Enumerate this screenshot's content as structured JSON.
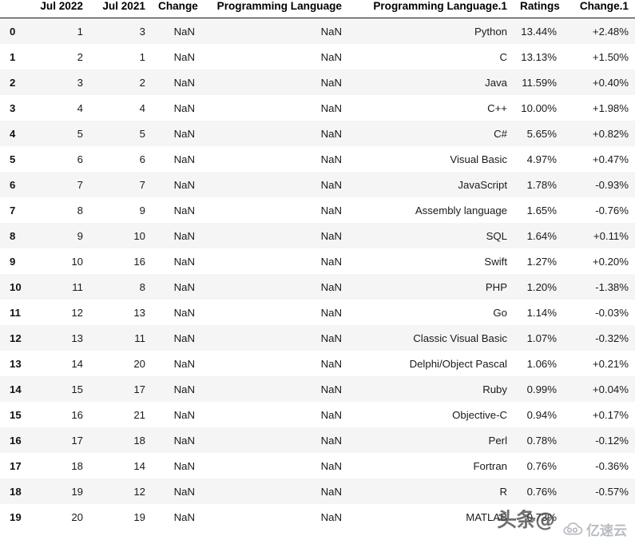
{
  "table": {
    "index_header": "",
    "columns": [
      "Jul 2022",
      "Jul 2021",
      "Change",
      "Programming Language",
      "Programming Language.1",
      "Ratings",
      "Change.1"
    ],
    "index": [
      "0",
      "1",
      "2",
      "3",
      "4",
      "5",
      "6",
      "7",
      "8",
      "9",
      "10",
      "11",
      "12",
      "13",
      "14",
      "15",
      "16",
      "17",
      "18",
      "19"
    ],
    "rows": [
      {
        "idx": "0",
        "jul2022": "1",
        "jul2021": "3",
        "change": "NaN",
        "lang": "NaN",
        "lang1": "Python",
        "ratings": "13.44%",
        "change1": "+2.48%"
      },
      {
        "idx": "1",
        "jul2022": "2",
        "jul2021": "1",
        "change": "NaN",
        "lang": "NaN",
        "lang1": "C",
        "ratings": "13.13%",
        "change1": "+1.50%"
      },
      {
        "idx": "2",
        "jul2022": "3",
        "jul2021": "2",
        "change": "NaN",
        "lang": "NaN",
        "lang1": "Java",
        "ratings": "11.59%",
        "change1": "+0.40%"
      },
      {
        "idx": "3",
        "jul2022": "4",
        "jul2021": "4",
        "change": "NaN",
        "lang": "NaN",
        "lang1": "C++",
        "ratings": "10.00%",
        "change1": "+1.98%"
      },
      {
        "idx": "4",
        "jul2022": "5",
        "jul2021": "5",
        "change": "NaN",
        "lang": "NaN",
        "lang1": "C#",
        "ratings": "5.65%",
        "change1": "+0.82%"
      },
      {
        "idx": "5",
        "jul2022": "6",
        "jul2021": "6",
        "change": "NaN",
        "lang": "NaN",
        "lang1": "Visual Basic",
        "ratings": "4.97%",
        "change1": "+0.47%"
      },
      {
        "idx": "6",
        "jul2022": "7",
        "jul2021": "7",
        "change": "NaN",
        "lang": "NaN",
        "lang1": "JavaScript",
        "ratings": "1.78%",
        "change1": "-0.93%"
      },
      {
        "idx": "7",
        "jul2022": "8",
        "jul2021": "9",
        "change": "NaN",
        "lang": "NaN",
        "lang1": "Assembly language",
        "ratings": "1.65%",
        "change1": "-0.76%"
      },
      {
        "idx": "8",
        "jul2022": "9",
        "jul2021": "10",
        "change": "NaN",
        "lang": "NaN",
        "lang1": "SQL",
        "ratings": "1.64%",
        "change1": "+0.11%"
      },
      {
        "idx": "9",
        "jul2022": "10",
        "jul2021": "16",
        "change": "NaN",
        "lang": "NaN",
        "lang1": "Swift",
        "ratings": "1.27%",
        "change1": "+0.20%"
      },
      {
        "idx": "10",
        "jul2022": "11",
        "jul2021": "8",
        "change": "NaN",
        "lang": "NaN",
        "lang1": "PHP",
        "ratings": "1.20%",
        "change1": "-1.38%"
      },
      {
        "idx": "11",
        "jul2022": "12",
        "jul2021": "13",
        "change": "NaN",
        "lang": "NaN",
        "lang1": "Go",
        "ratings": "1.14%",
        "change1": "-0.03%"
      },
      {
        "idx": "12",
        "jul2022": "13",
        "jul2021": "11",
        "change": "NaN",
        "lang": "NaN",
        "lang1": "Classic Visual Basic",
        "ratings": "1.07%",
        "change1": "-0.32%"
      },
      {
        "idx": "13",
        "jul2022": "14",
        "jul2021": "20",
        "change": "NaN",
        "lang": "NaN",
        "lang1": "Delphi/Object Pascal",
        "ratings": "1.06%",
        "change1": "+0.21%"
      },
      {
        "idx": "14",
        "jul2022": "15",
        "jul2021": "17",
        "change": "NaN",
        "lang": "NaN",
        "lang1": "Ruby",
        "ratings": "0.99%",
        "change1": "+0.04%"
      },
      {
        "idx": "15",
        "jul2022": "16",
        "jul2021": "21",
        "change": "NaN",
        "lang": "NaN",
        "lang1": "Objective-C",
        "ratings": "0.94%",
        "change1": "+0.17%"
      },
      {
        "idx": "16",
        "jul2022": "17",
        "jul2021": "18",
        "change": "NaN",
        "lang": "NaN",
        "lang1": "Perl",
        "ratings": "0.78%",
        "change1": "-0.12%"
      },
      {
        "idx": "17",
        "jul2022": "18",
        "jul2021": "14",
        "change": "NaN",
        "lang": "NaN",
        "lang1": "Fortran",
        "ratings": "0.76%",
        "change1": "-0.36%"
      },
      {
        "idx": "18",
        "jul2022": "19",
        "jul2021": "12",
        "change": "NaN",
        "lang": "NaN",
        "lang1": "R",
        "ratings": "0.76%",
        "change1": "-0.57%"
      },
      {
        "idx": "19",
        "jul2022": "20",
        "jul2021": "19",
        "change": "NaN",
        "lang": "NaN",
        "lang1": "MATLAB",
        "ratings": "0.73%",
        "change1": ""
      }
    ]
  },
  "watermarks": {
    "toutiao": "头条@",
    "yisuyun": "亿速云",
    "yisuyun_icon": "cloud-logo-icon"
  },
  "colors": {
    "row_even_bg": "#f5f5f5",
    "row_odd_bg": "#ffffff",
    "header_rule": "#111111",
    "text": "#1a1a1a",
    "watermark_gray": "#b8bcc2"
  }
}
